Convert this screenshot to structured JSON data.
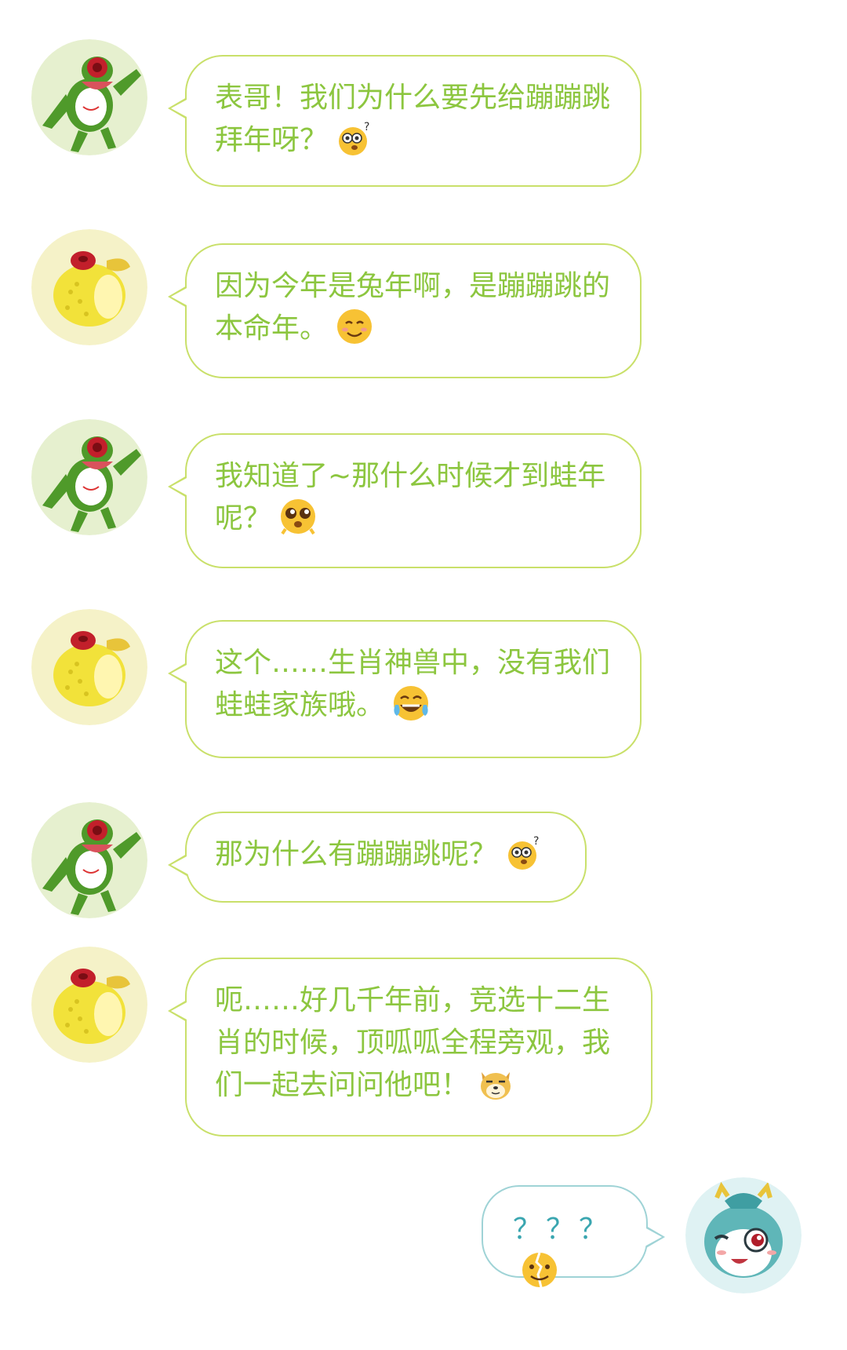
{
  "colors": {
    "text_green": "#8cc63f",
    "bubble_border_green": "#c9e06a",
    "text_teal": "#3aa6b0",
    "bubble_border_teal": "#9fd3d6",
    "frog_bg": "#e6f0cf",
    "toad_bg": "#f5f2c8",
    "dragon_bg": "#dff2f3"
  },
  "messages": [
    {
      "speaker": "frog",
      "text": "表哥！我们为什么要先给蹦蹦跳拜年呀？",
      "emoji": "confused-face-icon"
    },
    {
      "speaker": "toad",
      "text": "因为今年是兔年啊，是蹦蹦跳的本命年。",
      "emoji": "smiling-face-icon"
    },
    {
      "speaker": "frog",
      "text": "我知道了~那什么时候才到蛙年呢？",
      "emoji": "pleading-face-icon"
    },
    {
      "speaker": "toad",
      "text": "这个……生肖神兽中，没有我们蛙蛙家族哦。",
      "emoji": "tears-of-joy-icon"
    },
    {
      "speaker": "frog",
      "text": "那为什么有蹦蹦跳呢？",
      "emoji": "confused-face-icon"
    },
    {
      "speaker": "toad",
      "text": "呃……好几千年前，竞选十二生肖的时候，顶呱呱全程旁观，我们一起去问问他吧！",
      "emoji": "doge-icon"
    },
    {
      "speaker": "dragon",
      "text": "？？？",
      "emoji": "cracked-face-icon"
    }
  ]
}
